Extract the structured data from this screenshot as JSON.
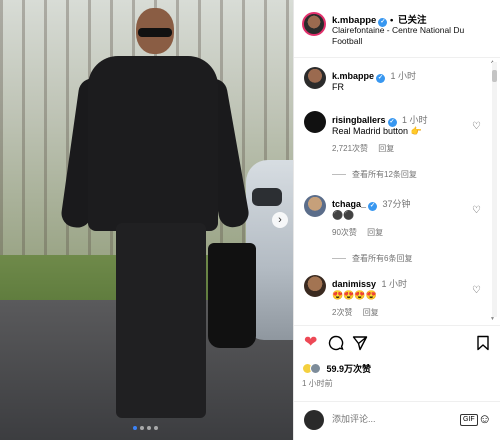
{
  "post": {
    "image_alt": "Player walking with black bag",
    "carousel_dots": 4,
    "active_dot": 0
  },
  "header": {
    "username": "k.mbappe",
    "follow_label": "已关注",
    "location": "Clairefontaine - Centre National Du Football"
  },
  "caption": {
    "username": "k.mbappe",
    "time": "1 小时",
    "text": "FR"
  },
  "comments": [
    {
      "username": "risingballers",
      "verified": true,
      "time": "1 小时",
      "text": "Real Madrid button 👉",
      "likes": "2,721次赞",
      "reply": "回复",
      "view_replies": "查看所有12条回复"
    },
    {
      "username": "tchaga_",
      "verified": true,
      "time": "37分钟",
      "text": "⚫⚫",
      "likes": "90次赞",
      "reply": "回复",
      "view_replies": "查看所有6条回复"
    },
    {
      "username": "danimissy",
      "verified": false,
      "time": "1 小时",
      "text": "😍😍😍😍",
      "likes": "2次赞",
      "reply": "回复"
    }
  ],
  "actions": {
    "like_icon": "heart-filled-icon",
    "comment_icon": "comment-icon",
    "share_icon": "send-icon",
    "save_icon": "bookmark-icon",
    "likes_text": "59.9万次赞",
    "posted_time": "1 小时前"
  },
  "comment_box": {
    "placeholder": "添加评论...",
    "gif_label": "GIF"
  },
  "colors": {
    "like_red": "#ed4956",
    "verified_blue": "#3897f0",
    "muted": "#737373"
  }
}
